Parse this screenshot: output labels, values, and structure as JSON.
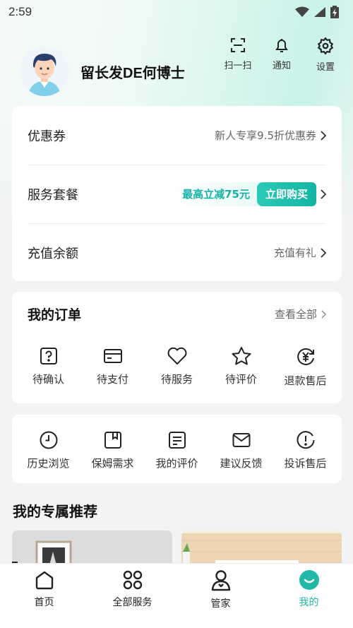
{
  "status_bar": {
    "time": "2:59"
  },
  "profile": {
    "username": "留长发DE何博士"
  },
  "top_actions": [
    {
      "label": "扫一扫",
      "icon": "scan-icon"
    },
    {
      "label": "通知",
      "icon": "bell-icon"
    },
    {
      "label": "设置",
      "icon": "gear-icon"
    }
  ],
  "benefits": {
    "coupon": {
      "label": "优惠券",
      "value": "新人专享9.5折优惠券"
    },
    "package": {
      "label": "服务套餐",
      "promo": "最高立减75元",
      "button": "立即购买"
    },
    "recharge": {
      "label": "充值余额",
      "value": "充值有礼"
    }
  },
  "orders": {
    "title": "我的订单",
    "view_all": "查看全部",
    "items": [
      {
        "label": "待确认",
        "icon": "question-box-icon"
      },
      {
        "label": "待支付",
        "icon": "card-icon"
      },
      {
        "label": "待服务",
        "icon": "heart-icon"
      },
      {
        "label": "待评价",
        "icon": "star-icon"
      },
      {
        "label": "退款售后",
        "icon": "refund-icon"
      }
    ]
  },
  "tools": {
    "items": [
      {
        "label": "历史浏览",
        "icon": "clock-icon"
      },
      {
        "label": "保姆需求",
        "icon": "bookmark-icon"
      },
      {
        "label": "我的评价",
        "icon": "comment-list-icon"
      },
      {
        "label": "建议反馈",
        "icon": "mail-icon"
      },
      {
        "label": "投诉售后",
        "icon": "alert-icon"
      }
    ]
  },
  "recommend": {
    "title": "我的专属推荐"
  },
  "bottom_nav": [
    {
      "label": "首页",
      "icon": "home-icon",
      "active": false
    },
    {
      "label": "全部服务",
      "icon": "grid-icon",
      "active": false
    },
    {
      "label": "管家",
      "icon": "butler-icon",
      "active": false
    },
    {
      "label": "我的",
      "icon": "smile-icon",
      "active": true
    }
  ],
  "colors": {
    "accent": "#21b8a8",
    "accent_light": "#d7f6ef"
  }
}
